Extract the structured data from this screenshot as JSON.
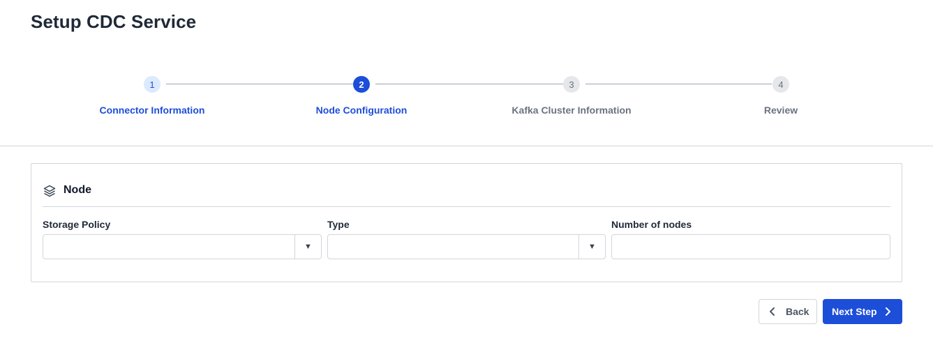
{
  "page": {
    "title": "Setup CDC Service"
  },
  "stepper": {
    "steps": [
      {
        "number": "1",
        "label": "Connector Information",
        "state": "done"
      },
      {
        "number": "2",
        "label": "Node Configuration",
        "state": "active"
      },
      {
        "number": "3",
        "label": "Kafka Cluster Information",
        "state": "pending"
      },
      {
        "number": "4",
        "label": "Review",
        "state": "pending"
      }
    ]
  },
  "node_section": {
    "title": "Node",
    "icon": "layers-icon",
    "fields": {
      "storage_policy": {
        "label": "Storage Policy",
        "value": ""
      },
      "type": {
        "label": "Type",
        "value": ""
      },
      "number_of_nodes": {
        "label": "Number of nodes",
        "value": ""
      }
    }
  },
  "actions": {
    "back_label": "Back",
    "next_label": "Next Step"
  },
  "colors": {
    "primary": "#1d4ed8",
    "primary_light": "#dbeafe",
    "border": "#d1d5db",
    "muted": "#6b7280"
  }
}
